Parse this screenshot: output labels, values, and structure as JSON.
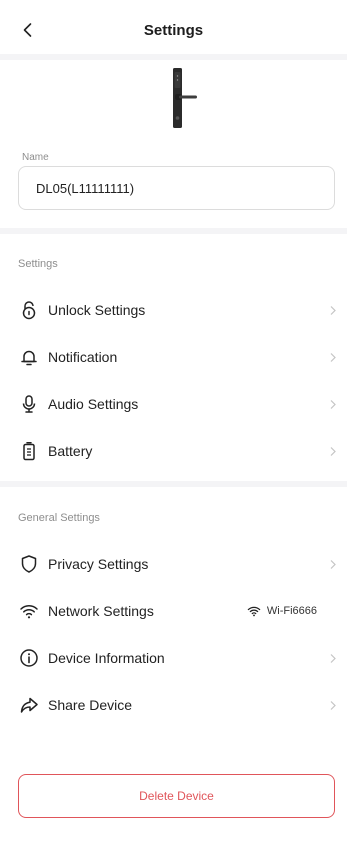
{
  "header": {
    "title": "Settings",
    "back_icon": "chevron-left-icon"
  },
  "device": {
    "name_label": "Name",
    "name_value": "DL05(L11111111)"
  },
  "settings_section": {
    "title": "Settings",
    "items": [
      {
        "label": "Unlock Settings",
        "icon": "unlock-icon"
      },
      {
        "label": "Notification",
        "icon": "bell-icon"
      },
      {
        "label": "Audio Settings",
        "icon": "microphone-icon"
      },
      {
        "label": "Battery",
        "icon": "battery-icon"
      }
    ]
  },
  "general_section": {
    "title": "General Settings",
    "items": [
      {
        "label": "Privacy Settings",
        "icon": "shield-icon"
      },
      {
        "label": "Network Settings",
        "icon": "wifi-icon",
        "value": "Wi-Fi6666"
      },
      {
        "label": "Device Information",
        "icon": "info-icon"
      },
      {
        "label": "Share Device",
        "icon": "share-icon"
      }
    ]
  },
  "footer": {
    "delete_label": "Delete Device"
  },
  "colors": {
    "danger": "#e0555a",
    "muted": "#8e8e8e",
    "divider": "#f4f4f6"
  }
}
